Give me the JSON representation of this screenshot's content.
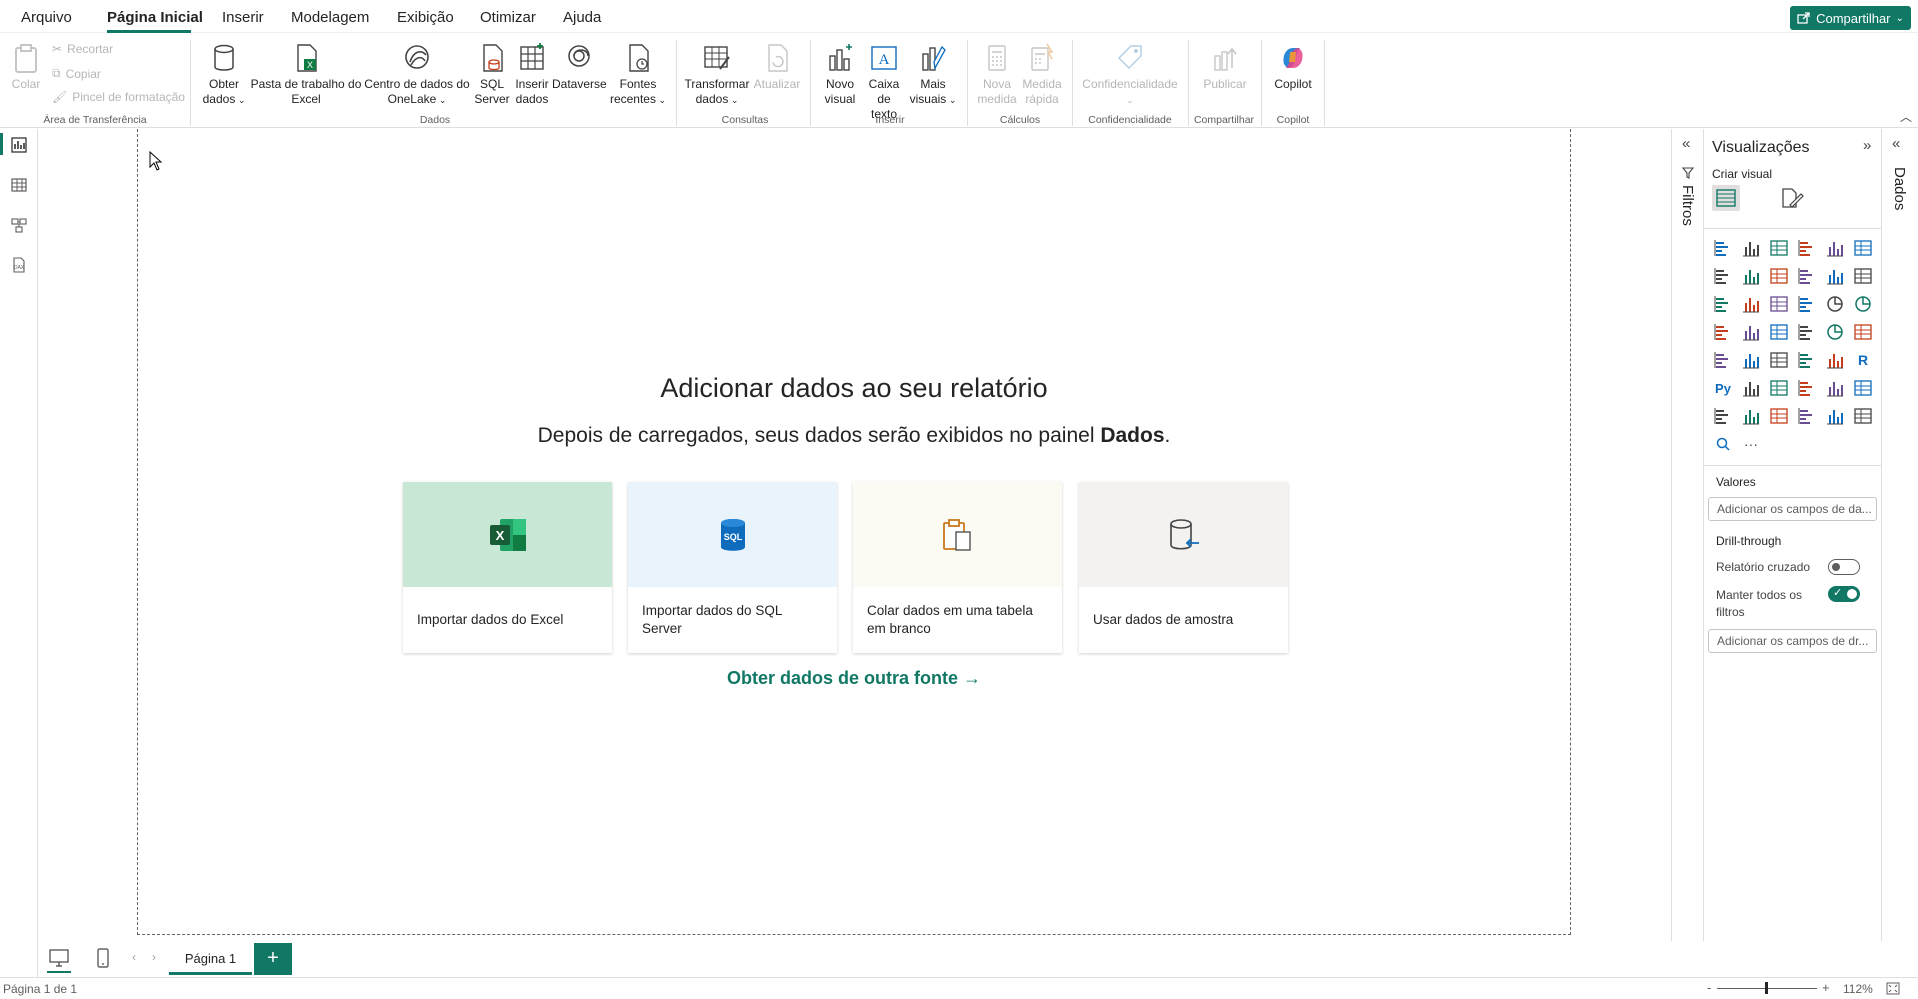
{
  "menu": {
    "tabs": [
      {
        "label": "Arquivo"
      },
      {
        "label": "Página Inicial"
      },
      {
        "label": "Inserir"
      },
      {
        "label": "Modelagem"
      },
      {
        "label": "Exibição"
      },
      {
        "label": "Otimizar"
      },
      {
        "label": "Ajuda"
      }
    ],
    "share_label": "Compartilhar"
  },
  "ribbon": {
    "clipboard": {
      "paste": "Colar",
      "cut": "Recortar",
      "copy": "Copiar",
      "format_painter": "Pincel de formatação",
      "group": "Área de Transferência"
    },
    "data": {
      "get_data_1": "Obter",
      "get_data_2": "dados",
      "excel_1": "Pasta de trabalho do",
      "excel_2": "Excel",
      "onelake_1": "Centro de dados do",
      "onelake_2": "OneLake",
      "sql_1": "SQL",
      "sql_2": "Server",
      "enter_1": "Inserir",
      "enter_2": "dados",
      "dataverse": "Dataverse",
      "recent_1": "Fontes",
      "recent_2": "recentes",
      "group": "Dados"
    },
    "queries": {
      "transform_1": "Transformar",
      "transform_2": "dados",
      "refresh": "Atualizar",
      "group": "Consultas"
    },
    "insert": {
      "new_visual_1": "Novo",
      "new_visual_2": "visual",
      "textbox_1": "Caixa de",
      "textbox_2": "texto",
      "more_1": "Mais",
      "more_2": "visuais",
      "group": "Inserir"
    },
    "calc": {
      "new_measure_1": "Nova",
      "new_measure_2": "medida",
      "quick_1": "Medida",
      "quick_2": "rápida",
      "group": "Cálculos"
    },
    "sensitivity": {
      "label": "Confidencialidade",
      "group": "Confidencialidade"
    },
    "share": {
      "label": "Publicar",
      "group": "Compartilhar"
    },
    "copilot": {
      "label": "Copilot",
      "group": "Copilot"
    }
  },
  "canvas": {
    "headline": "Adicionar dados ao seu relatório",
    "subline_pre": "Depois de carregados, seus dados serão exibidos no painel ",
    "subline_bold": "Dados",
    "subline_post": ".",
    "cards": [
      {
        "label": "Importar dados do Excel"
      },
      {
        "label": "Importar dados do SQL Server"
      },
      {
        "label": "Colar dados em uma tabela em branco"
      },
      {
        "label": "Usar dados de amostra"
      }
    ],
    "other_source": "Obter dados de outra fonte →"
  },
  "filters": {
    "label": "Filtros"
  },
  "visualizations": {
    "title": "Visualizações",
    "build_visual": "Criar visual",
    "values_label": "Valores",
    "values_placeholder": "Adicionar os campos de da...",
    "drillthrough_label": "Drill-through",
    "cross_report": "Relatório cruzado",
    "cross_report_on": false,
    "keep_filters_1": "Manter todos os",
    "keep_filters_2": "filtros",
    "keep_filters_on": true,
    "drill_placeholder": "Adicionar os campos de dr..."
  },
  "data_pane": {
    "label": "Dados"
  },
  "pages": {
    "tabs": [
      {
        "label": "Página 1"
      }
    ],
    "add": "+"
  },
  "status": {
    "page_info": "Página 1 de 1",
    "zoom_minus": "-",
    "zoom_plus": "+",
    "zoom": "112%"
  },
  "colors": {
    "accent": "#117865",
    "excel_tile": "#c8e8d5",
    "sql_tile": "#e8f3fc",
    "paste_tile": "#fbfbf4",
    "sample_tile": "#f3f2f1"
  }
}
